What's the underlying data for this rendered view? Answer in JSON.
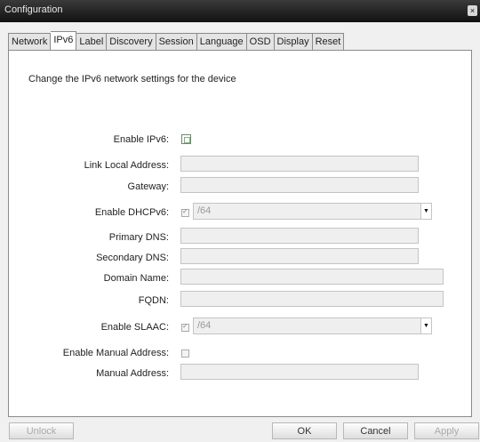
{
  "window": {
    "title": "Configuration",
    "close_label": "×"
  },
  "tabs": [
    "Network",
    "IPv6",
    "Label",
    "Discovery",
    "Session",
    "Language",
    "OSD",
    "Display",
    "Reset"
  ],
  "panel": {
    "description": "Change the IPv6 network settings for the device",
    "enable_ipv6_label": "Enable IPv6:",
    "link_local_label": "Link Local Address:",
    "link_local_value": "",
    "gateway_label": "Gateway:",
    "gateway_value": "",
    "dhcpv6_label": "Enable DHCPv6:",
    "dhcpv6_select": "/64",
    "primary_dns_label": "Primary DNS:",
    "primary_dns_value": "",
    "secondary_dns_label": "Secondary DNS:",
    "secondary_dns_value": "",
    "domain_name_label": "Domain Name:",
    "domain_name_value": "",
    "fqdn_label": "FQDN:",
    "fqdn_value": "",
    "slaac_label": "Enable SLAAC:",
    "slaac_select": "/64",
    "manual_addr_enable_label": "Enable Manual Address:",
    "manual_addr_label": "Manual Address:",
    "manual_addr_value": ""
  },
  "buttons": {
    "unlock": "Unlock",
    "ok": "OK",
    "cancel": "Cancel",
    "apply": "Apply"
  }
}
